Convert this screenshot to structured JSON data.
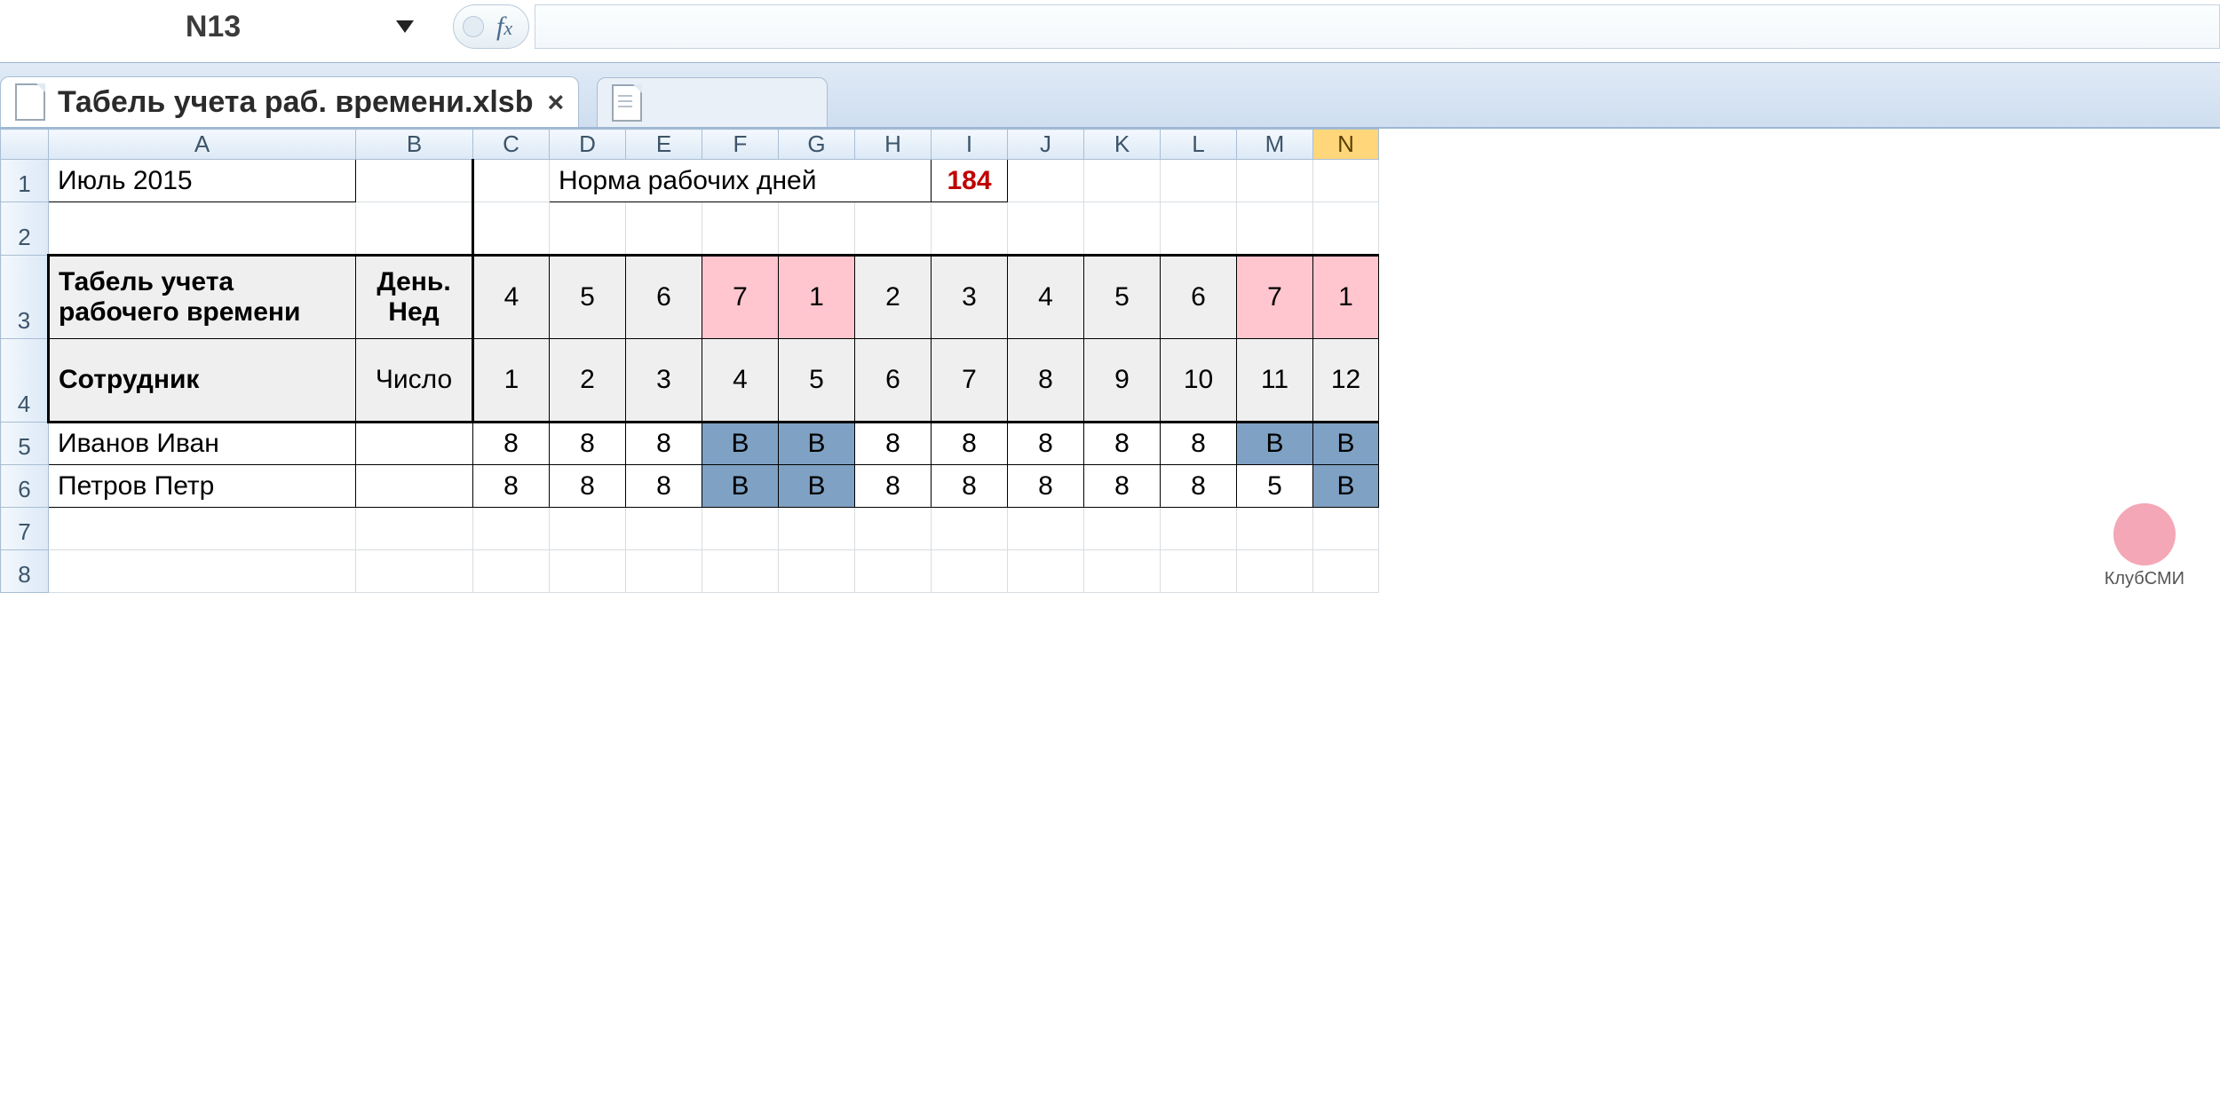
{
  "name_box": "N13",
  "formula_bar_value": "",
  "tabs": {
    "active_title": "Табель учета раб. времени.xlsb",
    "inactive_title": ""
  },
  "columns": [
    "A",
    "B",
    "C",
    "D",
    "E",
    "F",
    "G",
    "H",
    "I",
    "J",
    "K",
    "L",
    "M",
    "N"
  ],
  "selected_column": "N",
  "row_numbers": [
    1,
    2,
    3,
    4,
    5,
    6,
    7,
    8
  ],
  "row1": {
    "period": "Июль 2015",
    "norm_label": "Норма рабочих дней",
    "norm_value": "184"
  },
  "header": {
    "title_r3": "Табель учета\nрабочего времени",
    "dayofweek_label": "День.\nНед",
    "employee_label": "Сотрудник",
    "date_label": "Число",
    "days_of_week": [
      "4",
      "5",
      "6",
      "7",
      "1",
      "2",
      "3",
      "4",
      "5",
      "6",
      "7",
      "1"
    ],
    "weekend_idx": [
      3,
      4,
      10,
      11
    ],
    "dates": [
      "1",
      "2",
      "3",
      "4",
      "5",
      "6",
      "7",
      "8",
      "9",
      "10",
      "11",
      "12"
    ]
  },
  "employees": [
    {
      "name": "Иванов Иван",
      "hours": [
        "8",
        "8",
        "8",
        "В",
        "В",
        "8",
        "8",
        "8",
        "8",
        "8",
        "В",
        "В"
      ],
      "weekend_idx": [
        3,
        4,
        10,
        11
      ]
    },
    {
      "name": "Петров Петр",
      "hours": [
        "8",
        "8",
        "8",
        "В",
        "В",
        "8",
        "8",
        "8",
        "8",
        "8",
        "5",
        "В"
      ],
      "weekend_idx": [
        3,
        4,
        11
      ]
    }
  ],
  "watermark": "КлубСМИ"
}
